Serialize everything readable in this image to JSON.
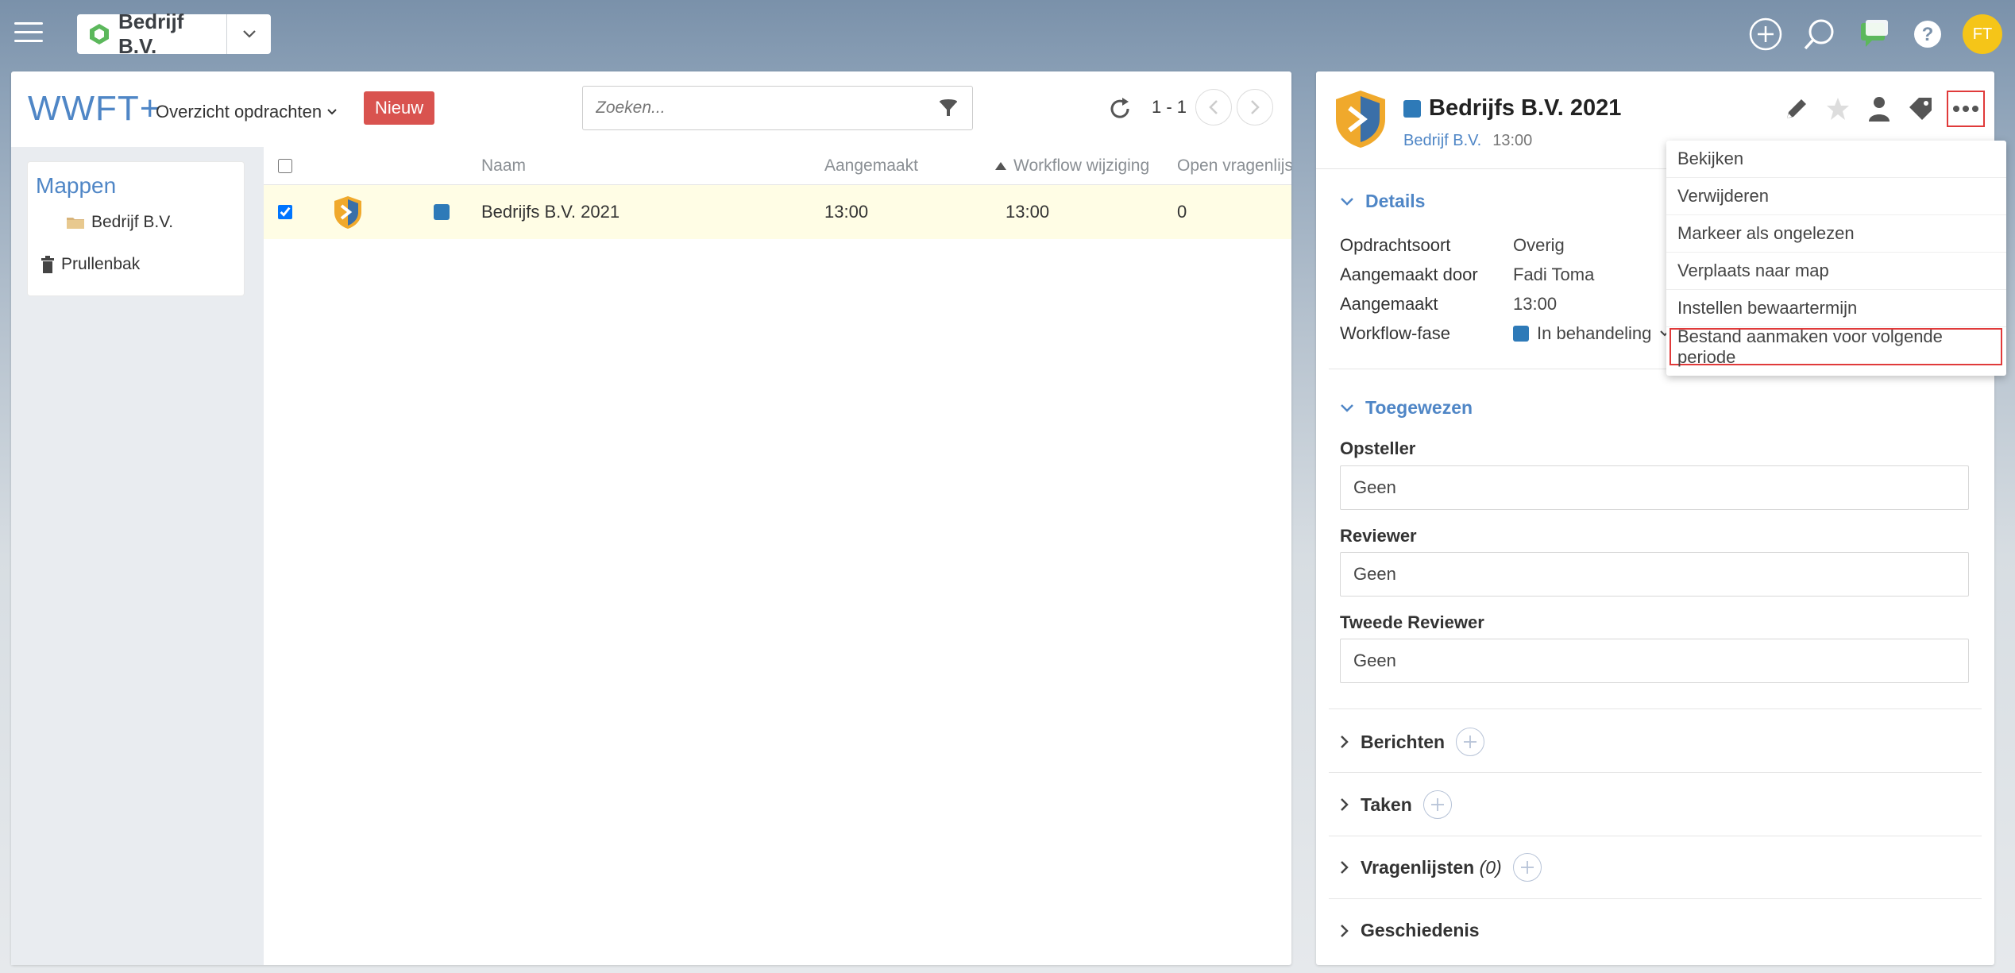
{
  "topbar": {
    "company_name": "Bedrijf B.V.",
    "avatar_initials": "FT",
    "icons": [
      "plus-circle-icon",
      "search-icon",
      "chat-icon",
      "help-icon"
    ]
  },
  "list": {
    "app_title": "WWFT+",
    "view_name": "Overzicht opdrachten",
    "new_label": "Nieuw",
    "search_placeholder": "Zoeken...",
    "paging": "1 - 1",
    "folders_title": "Mappen",
    "folder_name": "Bedrijf B.V.",
    "trash_label": "Prullenbak",
    "columns": {
      "name": "Naam",
      "created": "Aangemaakt",
      "workflow_change": "Workflow wijziging",
      "open_questionnaires": "Open vragenlijsten"
    },
    "rows": [
      {
        "name": "Bedrijfs B.V. 2021",
        "created": "13:00",
        "workflow_change": "13:00",
        "open_questionnaires": "0",
        "checked": true,
        "status_color": "#2e7ab8"
      }
    ]
  },
  "detail": {
    "title": "Bedrijfs B.V. 2021",
    "company_link": "Bedrijf B.V.",
    "time": "13:00",
    "details_header": "Details",
    "details": {
      "type_label": "Opdrachtsoort",
      "type_value": "Overig",
      "created_by_label": "Aangemaakt door",
      "created_by_value": "Fadi Toma",
      "created_label": "Aangemaakt",
      "created_value": "13:00",
      "phase_label": "Workflow-fase",
      "phase_value": "In behandeling"
    },
    "assigned_header": "Toegewezen",
    "preparer_label": "Opsteller",
    "preparer_value": "Geen",
    "reviewer_label": "Reviewer",
    "reviewer_value": "Geen",
    "second_reviewer_label": "Tweede Reviewer",
    "second_reviewer_value": "Geen",
    "messages_label": "Berichten",
    "tasks_label": "Taken",
    "questionnaires_label": "Vragenlijsten",
    "questionnaires_count": "(0)",
    "history_label": "Geschiedenis"
  },
  "menu": {
    "items": [
      "Bekijken",
      "Verwijderen",
      "Markeer als ongelezen",
      "Verplaats naar map",
      "Instellen bewaartermijn",
      "Bestand aanmaken voor volgende periode"
    ]
  },
  "colors": {
    "accent": "#4f86c6",
    "new_button": "#d9534f",
    "status_blue": "#2e7ab8",
    "highlight_border": "#e03a3a",
    "selected_row": "#fffde5",
    "avatar": "#f5c518"
  }
}
